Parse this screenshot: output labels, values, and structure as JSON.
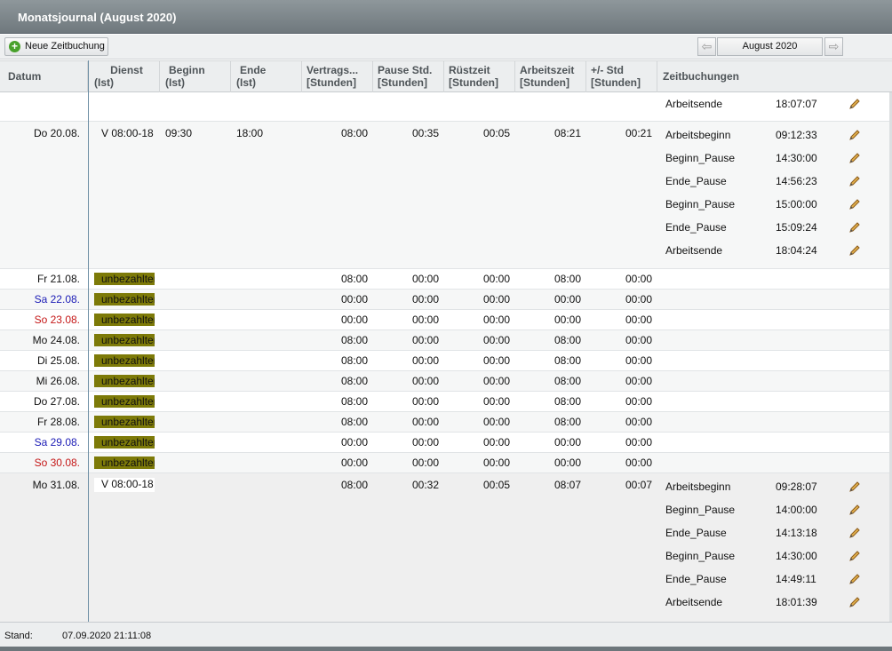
{
  "window": {
    "title": "Monatsjournal (August 2020)"
  },
  "toolbar": {
    "new_booking_label": "Neue Zeitbuchung",
    "month_label": "August 2020",
    "prev_icon": "arrow-left-icon",
    "next_icon": "arrow-right-icon"
  },
  "columns": {
    "datum": "Datum",
    "dienst_1": "Dienst",
    "dienst_2": "(Ist)",
    "beginn_1": "Beginn",
    "beginn_2": "(Ist)",
    "ende_1": "Ende",
    "ende_2": "(Ist)",
    "vertrag_1": "Vertrags...",
    "vertrag_2": "[Stunden]",
    "pause_1": "Pause Std.",
    "pause_2": "[Stunden]",
    "ruest_1": "Rüstzeit",
    "ruest_2": "[Stunden]",
    "arbeit_1": "Arbeitszeit",
    "arbeit_2": "[Stunden]",
    "diff_1": "+/- Std",
    "diff_2": "[Stunden]",
    "buchungen": "Zeitbuchungen"
  },
  "top_partial": {
    "label": "Arbeitsende",
    "time": "18:07:07"
  },
  "day_20": {
    "date": "Do 20.08.",
    "dienst": "V 08:00-18",
    "beginn": "09:30",
    "ende": "18:00",
    "vertrag": "08:00",
    "pause": "00:35",
    "ruest": "00:05",
    "arbeit": "08:21",
    "diff": "00:21",
    "bookings": [
      {
        "label": "Arbeitsbeginn",
        "time": "09:12:33"
      },
      {
        "label": "Beginn_Pause",
        "time": "14:30:00"
      },
      {
        "label": "Ende_Pause",
        "time": "14:56:23"
      },
      {
        "label": "Beginn_Pause",
        "time": "15:00:00"
      },
      {
        "label": "Ende_Pause",
        "time": "15:09:24"
      },
      {
        "label": "Arbeitsende",
        "time": "18:04:24"
      }
    ]
  },
  "simple_days": [
    {
      "date": "Fr 21.08.",
      "dienst": "unbezahlter",
      "vertrag": "08:00",
      "pause": "00:00",
      "ruest": "00:00",
      "arbeit": "08:00",
      "diff": "00:00"
    },
    {
      "date": "Sa 22.08.",
      "dienst": "unbezahlter",
      "vertrag": "00:00",
      "pause": "00:00",
      "ruest": "00:00",
      "arbeit": "00:00",
      "diff": "00:00"
    },
    {
      "date": "So 23.08.",
      "dienst": "unbezahlter",
      "vertrag": "00:00",
      "pause": "00:00",
      "ruest": "00:00",
      "arbeit": "00:00",
      "diff": "00:00"
    },
    {
      "date": "Mo 24.08.",
      "dienst": "unbezahlter",
      "vertrag": "08:00",
      "pause": "00:00",
      "ruest": "00:00",
      "arbeit": "08:00",
      "diff": "00:00"
    },
    {
      "date": "Di 25.08.",
      "dienst": "unbezahlter",
      "vertrag": "08:00",
      "pause": "00:00",
      "ruest": "00:00",
      "arbeit": "08:00",
      "diff": "00:00"
    },
    {
      "date": "Mi 26.08.",
      "dienst": "unbezahlter",
      "vertrag": "08:00",
      "pause": "00:00",
      "ruest": "00:00",
      "arbeit": "08:00",
      "diff": "00:00"
    },
    {
      "date": "Do 27.08.",
      "dienst": "unbezahlter",
      "vertrag": "08:00",
      "pause": "00:00",
      "ruest": "00:00",
      "arbeit": "08:00",
      "diff": "00:00"
    },
    {
      "date": "Fr 28.08.",
      "dienst": "unbezahlter",
      "vertrag": "08:00",
      "pause": "00:00",
      "ruest": "00:00",
      "arbeit": "08:00",
      "diff": "00:00"
    },
    {
      "date": "Sa 29.08.",
      "dienst": "unbezahlter",
      "vertrag": "00:00",
      "pause": "00:00",
      "ruest": "00:00",
      "arbeit": "00:00",
      "diff": "00:00"
    },
    {
      "date": "So 30.08.",
      "dienst": "unbezahlter",
      "vertrag": "00:00",
      "pause": "00:00",
      "ruest": "00:00",
      "arbeit": "00:00",
      "diff": "00:00"
    }
  ],
  "day_31": {
    "date": "Mo 31.08.",
    "dienst": "V 08:00-18",
    "vertrag": "08:00",
    "pause": "00:32",
    "ruest": "00:05",
    "arbeit": "08:07",
    "diff": "00:07",
    "bookings": [
      {
        "label": "Arbeitsbeginn",
        "time": "09:28:07"
      },
      {
        "label": "Beginn_Pause",
        "time": "14:00:00"
      },
      {
        "label": "Ende_Pause",
        "time": "14:13:18"
      },
      {
        "label": "Beginn_Pause",
        "time": "14:30:00"
      },
      {
        "label": "Ende_Pause",
        "time": "14:49:11"
      },
      {
        "label": "Arbeitsende",
        "time": "18:01:39"
      }
    ]
  },
  "footer": {
    "stand_label": "Stand:",
    "stand_value": "07.09.2020 21:11:08"
  },
  "colors": {
    "badge": "#7d7a08",
    "saturday": "#1a1ab5",
    "sunday": "#c41515"
  }
}
